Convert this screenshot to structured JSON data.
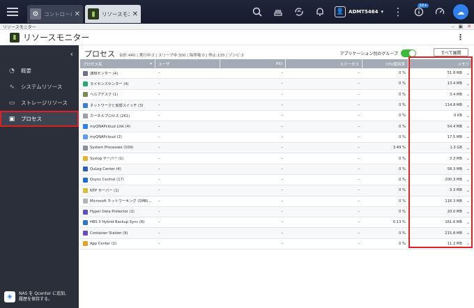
{
  "taskbar": {
    "tabs": [
      {
        "label": "コントロール",
        "icon": "gear-icon",
        "active": false
      },
      {
        "label": "リソースモニ…",
        "icon": "resource-monitor-icon",
        "active": true
      }
    ],
    "user": "ADMT5464",
    "badge": "10+"
  },
  "window": {
    "title": "リソースモニター"
  },
  "app": {
    "title": "リソースモニター"
  },
  "sidebar": {
    "items": [
      {
        "label": "概要",
        "icon": "gauge-icon"
      },
      {
        "label": "システムリソース",
        "icon": "chart-icon"
      },
      {
        "label": "ストレージリソース",
        "icon": "storage-icon"
      },
      {
        "label": "プロセス",
        "icon": "process-icon",
        "active": true
      }
    ],
    "footer_line1": "NAS を Qcenter に追加,",
    "footer_line2": "履歴を保持する。"
  },
  "process": {
    "title": "プロセス",
    "stats": "合計:440 | 実行中:2 | スリープ中:300 | 除停電:0 | 停止:135 | ゾンビ:3",
    "group_label": "アプリケーション別のグループ",
    "expand_all": "すべて展開",
    "columns": {
      "name": "プロセス名",
      "user": "ユーザ",
      "pid": "PID",
      "status": "ステータス",
      "cpu": "CPU使用率",
      "mem": "メモリ"
    },
    "rows": [
      {
        "name": "通知センター (4)",
        "user": "–",
        "pid": "–",
        "status": "–",
        "cpu": "0 %",
        "mem": "51.8 MB",
        "color": "#6a7488"
      },
      {
        "name": "ライセンスセンター (4)",
        "user": "–",
        "pid": "–",
        "status": "–",
        "cpu": "0 %",
        "mem": "13.4 MB",
        "color": "#2aa876"
      },
      {
        "name": "ヘルプデスク (1)",
        "user": "–",
        "pid": "–",
        "status": "–",
        "cpu": "0 %",
        "mem": "3.4 MB",
        "color": "#7a8a55"
      },
      {
        "name": "ネットワークと仮想スイッチ (3)",
        "user": "–",
        "pid": "–",
        "status": "–",
        "cpu": "0 %",
        "mem": "114.8 MB",
        "color": "#3b7dd8"
      },
      {
        "name": "カーネルプロセス (261)",
        "user": "–",
        "pid": "–",
        "status": "–",
        "cpu": "0 %",
        "mem": "0 KB",
        "color": "#9aa0aa"
      },
      {
        "name": "myQNAPcloud Link (4)",
        "user": "–",
        "pid": "–",
        "status": "–",
        "cpu": "0 %",
        "mem": "54.4 MB",
        "color": "#2f80ed"
      },
      {
        "name": "myQNAPcloud (2)",
        "user": "–",
        "pid": "–",
        "status": "–",
        "cpu": "0 %",
        "mem": "17.5 MB",
        "color": "#5aa0f0"
      },
      {
        "name": "System Processes (109)",
        "user": "–",
        "pid": "–",
        "status": "–",
        "cpu": "3.49 %",
        "mem": "1.3 GB",
        "color": "#8a8f99"
      },
      {
        "name": "Syslog サーバー (1)",
        "user": "–",
        "pid": "–",
        "status": "–",
        "cpu": "0 %",
        "mem": "3.3 MB",
        "color": "#e8b030"
      },
      {
        "name": "QuLog Center (4)",
        "user": "–",
        "pid": "–",
        "status": "–",
        "cpu": "0 %",
        "mem": "58.3 MB",
        "color": "#2b5fb8"
      },
      {
        "name": "Qsync Central (17)",
        "user": "–",
        "pid": "–",
        "status": "–",
        "cpu": "0 %",
        "mem": "200.3 MB",
        "color": "#1f6fd0"
      },
      {
        "name": "NTP サーバー (1)",
        "user": "–",
        "pid": "–",
        "status": "–",
        "cpu": "0 %",
        "mem": "3.3 MB",
        "color": "#d6c030"
      },
      {
        "name": "Microsoft ネットワーキング (SMB)...",
        "user": "–",
        "pid": "–",
        "status": "–",
        "cpu": "0 %",
        "mem": "116.3 MB",
        "color": "#b0b4bb"
      },
      {
        "name": "Hyper Data Protector (1)",
        "user": "–",
        "pid": "–",
        "status": "–",
        "cpu": "0 %",
        "mem": "20.0 MB",
        "color": "#5a4fc8"
      },
      {
        "name": "HBS 3 Hybrid Backup Sync (8)",
        "user": "–",
        "pid": "–",
        "status": "–",
        "cpu": "0.13 %",
        "mem": "161.6 MB",
        "color": "#2a78c8"
      },
      {
        "name": "Container Station (9)",
        "user": "–",
        "pid": "–",
        "status": "–",
        "cpu": "0 %",
        "mem": "215.8 MB",
        "color": "#6a4fc0"
      },
      {
        "name": "App Center (1)",
        "user": "–",
        "pid": "–",
        "status": "–",
        "cpu": "0 %",
        "mem": "11.2 MB",
        "color": "#e8a020"
      }
    ]
  }
}
